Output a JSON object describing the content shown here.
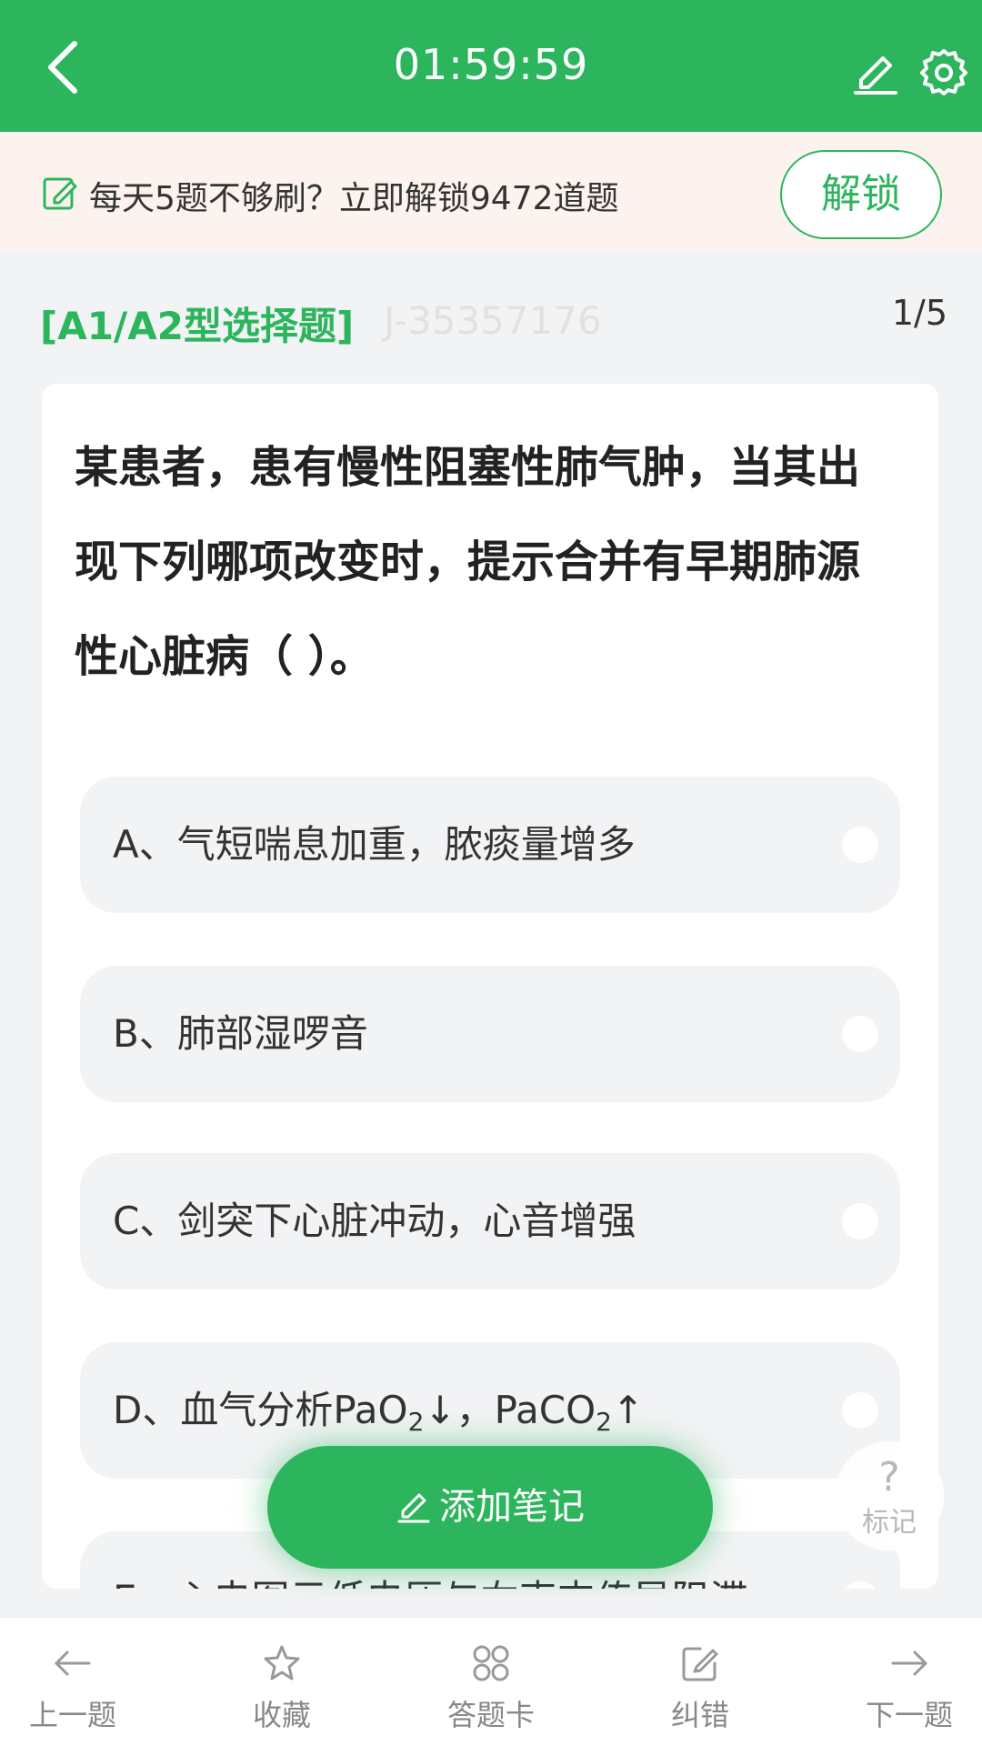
{
  "header": {
    "timer": "01:59:59",
    "icons": {
      "back": "back-arrow-icon",
      "edit": "pencil-icon",
      "settings": "gear-icon"
    }
  },
  "promo": {
    "text": "每天5题不够刷？立即解锁9472道题",
    "button_label": "解锁"
  },
  "question": {
    "type_label": "[A1/A2型选择题]",
    "id": "J-35357176",
    "progress": "1/5",
    "stem": "某患者，患有慢性阻塞性肺气肿，当其出现下列哪项改变时，提示合并有早期肺源性心脏病（ ）。",
    "options": [
      {
        "label": "A、气短喘息加重，脓痰量增多"
      },
      {
        "label": "B、肺部湿啰音"
      },
      {
        "label": "C、剑突下心脏冲动，心音增强"
      },
      {
        "prefix": "D、血气分析PaO",
        "sub1": "2",
        "mid": "↓，PaCO",
        "sub2": "2",
        "suffix": "↑"
      },
      {
        "label": "E、心电图示低电压与右束支传导阻滞"
      }
    ]
  },
  "floating": {
    "add_note_label": "添加笔记",
    "mark_symbol": "?",
    "mark_label": "标记"
  },
  "bottom_nav": {
    "items": [
      {
        "label": "上一题",
        "icon": "left-arrow-icon"
      },
      {
        "label": "收藏",
        "icon": "star-icon"
      },
      {
        "label": "答题卡",
        "icon": "grid-icon"
      },
      {
        "label": "纠错",
        "icon": "edit-icon"
      },
      {
        "label": "下一题",
        "icon": "right-arrow-icon"
      }
    ]
  },
  "colors": {
    "primary": "#2db55d",
    "promo_bg": "#fcf2ee",
    "page_bg": "#f2f3f5"
  }
}
